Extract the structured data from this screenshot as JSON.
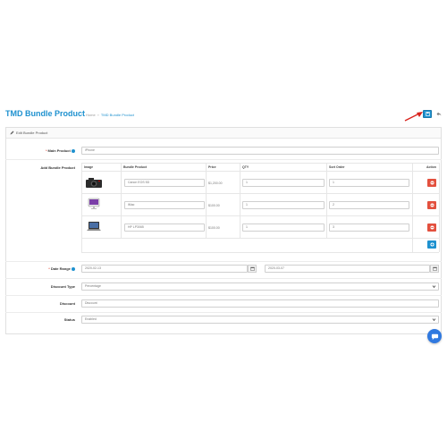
{
  "header": {
    "title": "TMD Bundle Product",
    "breadcrumb": [
      "Home",
      "TMD Bundle Product"
    ],
    "save_icon": "save-icon",
    "back_icon": "reply-icon"
  },
  "panel": {
    "heading": "Edit Bundle Product"
  },
  "form": {
    "main_product": {
      "label": "Main Product",
      "value": "iPhone"
    },
    "add_bundle": {
      "label": "Add Bundle Product",
      "columns": [
        "Image",
        "Bundle Product",
        "Price",
        "QTY",
        "Sort Order",
        "Action"
      ],
      "rows": [
        {
          "image": "camera",
          "product": "Canon EOS 5D",
          "price": "$1,200.00",
          "qty": "1",
          "sort": "1"
        },
        {
          "image": "imac",
          "product": "iMac",
          "price": "$100.00",
          "qty": "1",
          "sort": "2"
        },
        {
          "image": "laptop",
          "product": "HP LP3065",
          "price": "$100.00",
          "qty": "1",
          "sort": "3"
        }
      ]
    },
    "date_range": {
      "label": "Date Range",
      "start": "2020-02-13",
      "end": "2020-03-07"
    },
    "discount_type": {
      "label": "Discount Type",
      "value": "Percentage"
    },
    "discount": {
      "label": "Discount",
      "placeholder": "Discount"
    },
    "status": {
      "label": "Status",
      "value": "Enabled"
    }
  },
  "colors": {
    "primary": "#1e91cf",
    "danger": "#e3503e",
    "chat": "#3079e0"
  }
}
